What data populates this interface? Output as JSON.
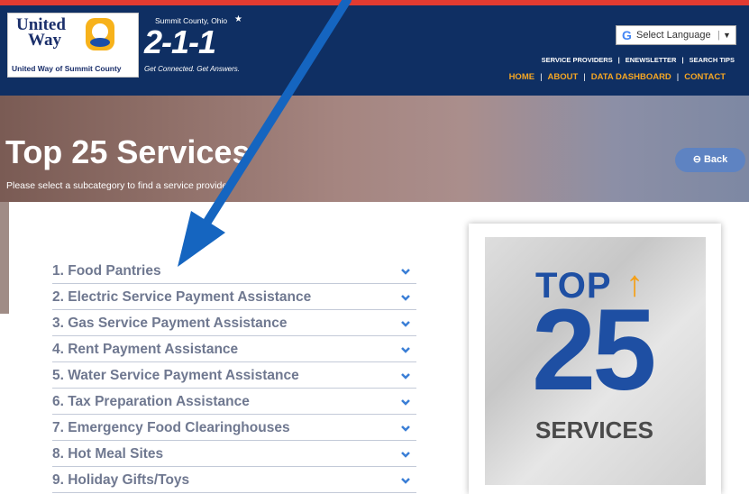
{
  "header": {
    "uw_name_line1": "United",
    "uw_name_line2": "Way",
    "uw_subtitle": "United Way of Summit County",
    "logo_top": "Summit County, Ohio",
    "logo_number": "2-1-1",
    "logo_tagline": "Get Connected. Get Answers.",
    "translate_label": "Select Language"
  },
  "nav_secondary": [
    "SERVICE PROVIDERS",
    "ENEWSLETTER",
    "SEARCH TIPS"
  ],
  "nav_primary": [
    "HOME",
    "ABOUT",
    "DATA DASHBOARD",
    "CONTACT"
  ],
  "hero": {
    "title": "Top 25 Services",
    "subtitle": "Please select a subcategory to find a service provider.",
    "back_label": "Back"
  },
  "services": [
    "1. Food Pantries",
    "2. Electric Service Payment Assistance",
    "3. Gas Service Payment Assistance",
    "4. Rent Payment Assistance",
    "5. Water Service Payment Assistance",
    "6. Tax Preparation Assistance",
    "7. Emergency Food Clearinghouses",
    "8. Hot Meal Sites",
    "9. Holiday Gifts/Toys"
  ],
  "poster": {
    "top": "TOP",
    "number": "25",
    "label": "SERVICES"
  },
  "colors": {
    "navy": "#0f2f63",
    "accent": "#f5a623",
    "red_bar": "#e23b31",
    "arrow": "#1565c0",
    "chevron": "#3b7fd6"
  }
}
